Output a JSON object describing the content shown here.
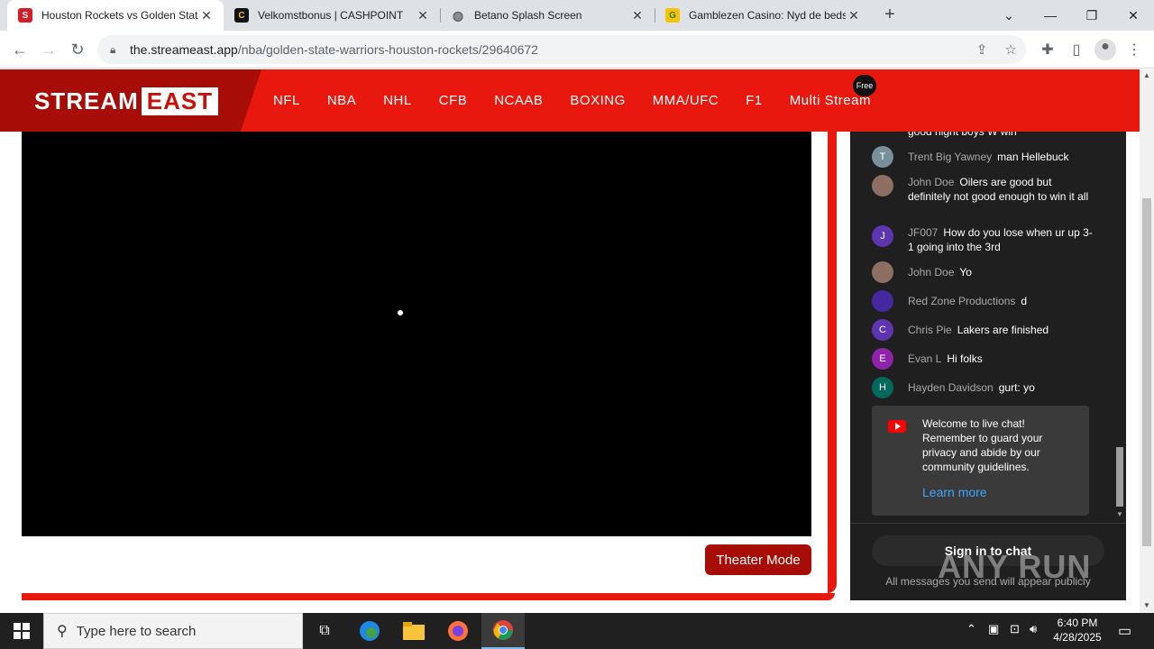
{
  "browser": {
    "tabs": [
      {
        "title": "Houston Rockets vs Golden State",
        "favicon": "S",
        "color": "#d21f2a",
        "active": true
      },
      {
        "title": "Velkomstbonus | CASHPOINT",
        "favicon": "C",
        "color": "#111111",
        "active": false
      },
      {
        "title": "Betano Splash Screen",
        "favicon": "",
        "color": "#5f6368",
        "active": false
      },
      {
        "title": "Gamblezen Casino: Nyd de bedste",
        "favicon": "G",
        "color": "#2e7d32",
        "active": false
      }
    ],
    "url_host": "the.streameast.app",
    "url_path": "/nba/golden-state-warriors-houston-rockets/29640672"
  },
  "site": {
    "logo_stream": "STREAM",
    "logo_east": "EAST",
    "nav": [
      "NFL",
      "NBA",
      "NHL",
      "CFB",
      "NCAAB",
      "BOXING",
      "MMA/UFC",
      "F1",
      "Multi Stream"
    ],
    "free_badge": "Free",
    "theater_mode": "Theater Mode",
    "accent_color": "#e8180e"
  },
  "chat": {
    "messages": [
      {
        "author": "",
        "text": "good night boys W win",
        "avatar": "",
        "avatar_color": "#1f1f1f"
      },
      {
        "author": "Trent Big Yawney",
        "text": "man Hellebuck",
        "avatar": "T",
        "avatar_color": "#78909c"
      },
      {
        "author": "John Doe",
        "text": "Oilers are good but definitely not good enough to win it all",
        "avatar": "",
        "avatar_color": "#8d6e63"
      },
      {
        "author": "JF007",
        "text": "How do you lose when ur up 3-1 going into the 3rd",
        "avatar": "J",
        "avatar_color": "#5e35b1"
      },
      {
        "author": "John Doe",
        "text": "Yo",
        "avatar": "",
        "avatar_color": "#8d6e63"
      },
      {
        "author": "Red Zone Productions",
        "text": "d",
        "avatar": "",
        "avatar_color": "#4527a0"
      },
      {
        "author": "Chris Pie",
        "text": "Lakers are finished",
        "avatar": "C",
        "avatar_color": "#5e35b1"
      },
      {
        "author": "Evan L",
        "text": "Hi folks",
        "avatar": "E",
        "avatar_color": "#8e24aa"
      },
      {
        "author": "Hayden Davidson",
        "text": "gurt: yo",
        "avatar": "H",
        "avatar_color": "#00695c"
      }
    ],
    "welcome_text": "Welcome to live chat! Remember to guard your privacy and abide by our community guidelines.",
    "learn_more": "Learn more",
    "sign_in": "Sign in to chat",
    "all_messages": "All messages you send will appear publicly"
  },
  "watermark": "ANY RUN",
  "taskbar": {
    "search_placeholder": "Type here to search",
    "time": "6:40 PM",
    "date": "4/28/2025"
  }
}
